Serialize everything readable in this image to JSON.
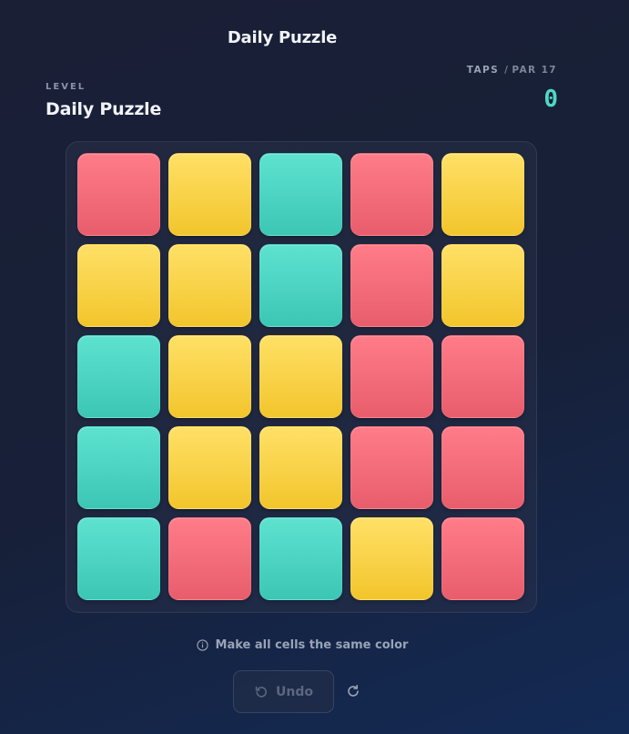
{
  "header": {
    "title": "Daily Puzzle"
  },
  "level": {
    "label": "LEVEL",
    "name": "Daily Puzzle"
  },
  "stats": {
    "taps_label": "TAPS",
    "separator": "/",
    "par_label": "PAR 17",
    "taps_count": "0"
  },
  "board": {
    "rows": 5,
    "cols": 5,
    "grid": [
      [
        "red",
        "yellow",
        "teal",
        "red",
        "yellow"
      ],
      [
        "yellow",
        "yellow",
        "teal",
        "red",
        "yellow"
      ],
      [
        "teal",
        "yellow",
        "yellow",
        "red",
        "red"
      ],
      [
        "teal",
        "yellow",
        "yellow",
        "red",
        "red"
      ],
      [
        "teal",
        "red",
        "teal",
        "yellow",
        "red"
      ]
    ],
    "colors": {
      "red": "#f06a78",
      "yellow": "#f9d54a",
      "teal": "#4dd6c3"
    }
  },
  "hint": {
    "icon": "info-icon",
    "text": "Make all cells the same color"
  },
  "controls": {
    "undo_label": "Undo",
    "undo_icon": "undo-icon",
    "undo_disabled": true,
    "reset_icon": "reset-icon"
  },
  "accent": "#4fd8c4"
}
